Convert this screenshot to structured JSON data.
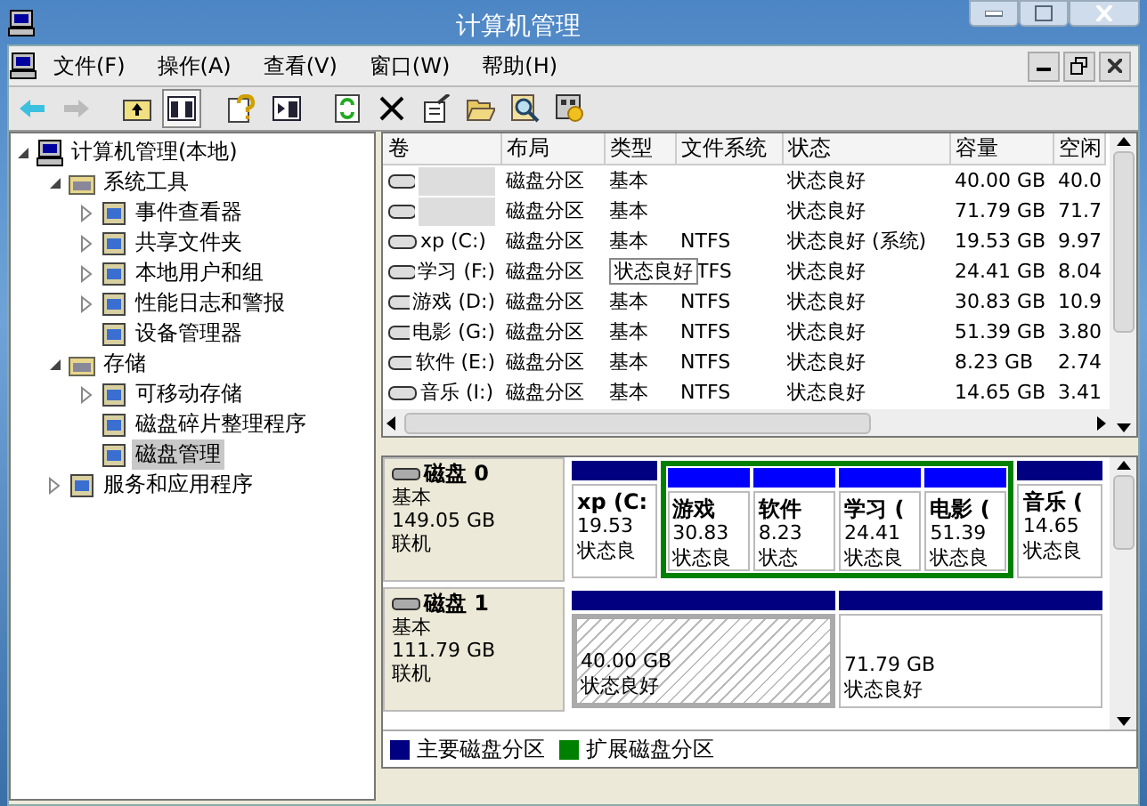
{
  "window": {
    "title": "计算机管理"
  },
  "menu": [
    "文件(F)",
    "操作(A)",
    "查看(V)",
    "窗口(W)",
    "帮助(H)"
  ],
  "tree": [
    {
      "label": "计算机管理(本地)",
      "selected": false,
      "expanded": true,
      "children": [
        {
          "label": "系统工具",
          "selected": false,
          "expanded": true,
          "children": [
            {
              "label": "事件查看器",
              "selected": false,
              "expanded": false
            },
            {
              "label": "共享文件夹",
              "selected": false,
              "expanded": false
            },
            {
              "label": "本地用户和组",
              "selected": false,
              "expanded": false
            },
            {
              "label": "性能日志和警报",
              "selected": false,
              "expanded": false
            },
            {
              "label": "设备管理器",
              "selected": false
            }
          ]
        },
        {
          "label": "存储",
          "selected": false,
          "expanded": true,
          "children": [
            {
              "label": "可移动存储",
              "selected": false,
              "expanded": false
            },
            {
              "label": "磁盘碎片整理程序",
              "selected": false
            },
            {
              "label": "磁盘管理",
              "selected": true
            }
          ]
        },
        {
          "label": "服务和应用程序",
          "selected": false,
          "expanded": false
        }
      ]
    }
  ],
  "table": {
    "columns": [
      "卷",
      "布局",
      "类型",
      "文件系统",
      "状态",
      "容量",
      "空闲"
    ],
    "rows": [
      {
        "layout": "磁盘分区",
        "type": "基本",
        "status": "状态良好",
        "capacity": "40.00 GB",
        "free": "40.0"
      },
      {
        "layout": "磁盘分区",
        "type": "基本",
        "status": "状态良好",
        "capacity": "71.79 GB",
        "free": "71.7"
      },
      {
        "volume": "xp (C:)",
        "layout": "磁盘分区",
        "type": "基本",
        "filesystem": "NTFS",
        "status": "状态良好 (系统)",
        "capacity": "19.53 GB",
        "free": "9.97"
      },
      {
        "volume": "学习 (F:)",
        "layout": "磁盘分区",
        "tooltip": "状态良好",
        "filesystem": "TFS",
        "status": "状态良好",
        "capacity": "24.41 GB",
        "free": "8.04"
      },
      {
        "volume": "游戏 (D:)",
        "layout": "磁盘分区",
        "type": "基本",
        "filesystem": "NTFS",
        "status": "状态良好",
        "capacity": "30.83 GB",
        "free": "10.9"
      },
      {
        "volume": "电影 (G:)",
        "layout": "磁盘分区",
        "type": "基本",
        "filesystem": "NTFS",
        "status": "状态良好",
        "capacity": "51.39 GB",
        "free": "3.80"
      },
      {
        "volume": "软件 (E:)",
        "layout": "磁盘分区",
        "type": "基本",
        "filesystem": "NTFS",
        "status": "状态良好",
        "capacity": "8.23 GB",
        "free": "2.74"
      },
      {
        "volume": "音乐 (I:)",
        "layout": "磁盘分区",
        "type": "基本",
        "filesystem": "NTFS",
        "status": "状态良好",
        "capacity": "14.65 GB",
        "free": "3.41"
      }
    ]
  },
  "disks": [
    {
      "name": "磁盘 0",
      "type": "基本",
      "size": "149.05 GB",
      "status": "联机",
      "partitions": [
        {
          "kind": "primary",
          "selected": false,
          "name": "xp (C:",
          "size": "19.53",
          "status": "状态良"
        },
        {
          "kind": "extended",
          "selected": false,
          "partitions": [
            {
              "kind": "logical",
              "selected": false,
              "name": "游戏",
              "size": "30.83",
              "status": "状态良"
            },
            {
              "kind": "logical",
              "selected": false,
              "name": "软件",
              "size": "8.23",
              "status": "状态"
            },
            {
              "kind": "logical",
              "selected": false,
              "name": "学习 (",
              "size": "24.41",
              "status": "状态良"
            },
            {
              "kind": "logical",
              "selected": false,
              "name": "电影 (",
              "size": "51.39",
              "status": "状态良"
            }
          ]
        },
        {
          "kind": "primary",
          "selected": false,
          "name": "音乐 (",
          "size": "14.65",
          "status": "状态良"
        }
      ]
    },
    {
      "name": "磁盘 1",
      "type": "基本",
      "size": "111.79 GB",
      "status": "联机",
      "partitions": [
        {
          "kind": "primary",
          "selected": true,
          "size": "40.00 GB",
          "status": "状态良好"
        },
        {
          "kind": "primary",
          "selected": false,
          "size": "71.79 GB",
          "status": "状态良好"
        }
      ]
    }
  ],
  "legend": [
    {
      "label": "主要磁盘分区",
      "color": "#000080"
    },
    {
      "label": "扩展磁盘分区",
      "color": "#008000"
    }
  ]
}
